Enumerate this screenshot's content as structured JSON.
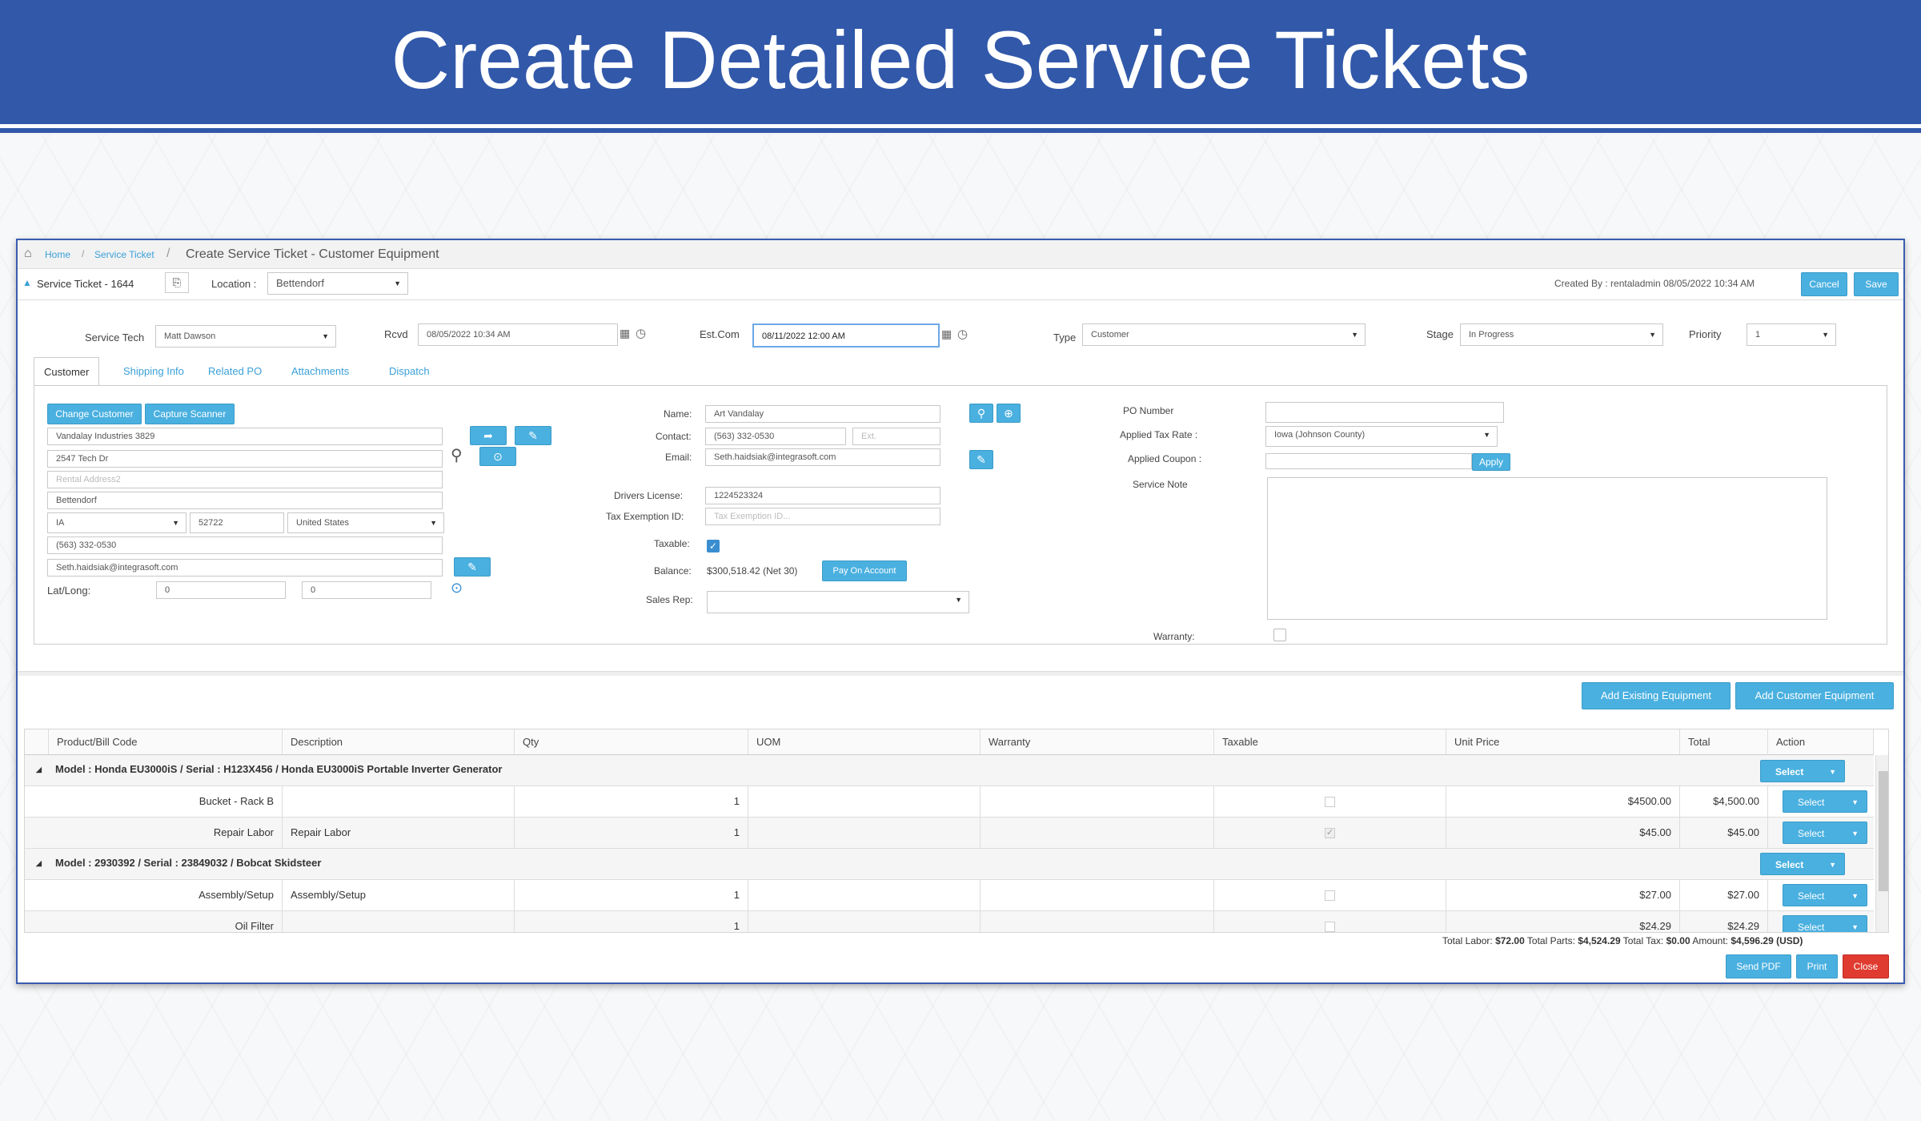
{
  "banner": {
    "title": "Create Detailed Service Tickets"
  },
  "breadcrumb": {
    "home": "Home",
    "service_ticket": "Service Ticket",
    "sep": "/",
    "current": "Create Service Ticket - Customer Equipment"
  },
  "header": {
    "ticket": "Service Ticket - 1644",
    "location_label": "Location :",
    "location_value": "Bettendorf",
    "created_by": "Created By : rentaladmin 08/05/2022 10:34 AM",
    "cancel": "Cancel",
    "save": "Save"
  },
  "fields": {
    "service_tech_label": "Service Tech",
    "service_tech": "Matt Dawson",
    "rcvd_label": "Rcvd",
    "rcvd": "08/05/2022 10:34 AM",
    "estcom_label": "Est.Com",
    "estcom": "08/11/2022 12:00 AM",
    "type_label": "Type",
    "type": "Customer",
    "stage_label": "Stage",
    "stage": "In Progress",
    "priority_label": "Priority",
    "priority": "1"
  },
  "tabs": [
    "Customer",
    "Shipping Info",
    "Related PO",
    "Attachments",
    "Dispatch"
  ],
  "customer": {
    "change": "Change Customer",
    "capture": "Capture Scanner",
    "company": "Vandalay Industries 3829",
    "address1": "2547 Tech Dr",
    "address2_placeholder": "Rental Address2",
    "city": "Bettendorf",
    "state": "IA",
    "zip": "52722",
    "country": "United States",
    "phone": "(563) 332-0530",
    "email": "Seth.haidsiak@integrasoft.com",
    "latlong_label": "Lat/Long:",
    "lat": "0",
    "long": "0"
  },
  "contact": {
    "name_label": "Name:",
    "name": "Art Vandalay",
    "contact_label": "Contact:",
    "contact": "(563) 332-0530",
    "ext_placeholder": "Ext.",
    "email_label": "Email:",
    "email": "Seth.haidsiak@integrasoft.com",
    "dl_label": "Drivers License:",
    "dl": "1224523324",
    "taxex_label": "Tax Exemption ID:",
    "taxex_placeholder": "Tax Exemption ID...",
    "taxable_label": "Taxable:",
    "balance_label": "Balance:",
    "balance": "$300,518.42 (Net 30)",
    "pay": "Pay On Account",
    "salesrep_label": "Sales Rep:"
  },
  "po": {
    "po_label": "PO Number",
    "tax_label": "Applied Tax Rate :",
    "tax": "Iowa (Johnson County)",
    "coupon_label": "Applied Coupon :",
    "apply": "Apply",
    "note_label": "Service Note",
    "warranty_label": "Warranty:"
  },
  "equipment": {
    "add_existing": "Add Existing Equipment",
    "add_customer": "Add Customer Equipment"
  },
  "table": {
    "headers": [
      "Product/Bill Code",
      "Description",
      "Qty",
      "UOM",
      "Warranty",
      "Taxable",
      "Unit Price",
      "Total",
      "Action"
    ],
    "group1": "Model : Honda EU3000iS / Serial : H123X456 / Honda EU3000iS Portable Inverter Generator",
    "group2": "Model : 2930392 / Serial : 23849032 / Bobcat Skidsteer",
    "select": "Select",
    "rows": [
      {
        "code": "Bucket - Rack B",
        "desc": "",
        "qty": "1",
        "unit": "$4500.00",
        "total": "$4,500.00"
      },
      {
        "code": "Repair Labor",
        "desc": "Repair Labor",
        "qty": "1",
        "unit": "$45.00",
        "total": "$45.00"
      },
      {
        "code": "Assembly/Setup",
        "desc": "Assembly/Setup",
        "qty": "1",
        "unit": "$27.00",
        "total": "$27.00"
      },
      {
        "code": "Oil Filter",
        "desc": "",
        "qty": "1",
        "unit": "$24.29",
        "total": "$24.29"
      }
    ]
  },
  "totals": {
    "labor_label": "Total Labor:",
    "labor": "$72.00",
    "parts_label": "Total Parts:",
    "parts": "$4,524.29",
    "tax_label": "Total Tax:",
    "tax": "$0.00",
    "amount_label": "Amount:",
    "amount": "$4,596.29 (USD)"
  },
  "footer": {
    "send_pdf": "Send PDF",
    "print": "Print",
    "close": "Close"
  }
}
